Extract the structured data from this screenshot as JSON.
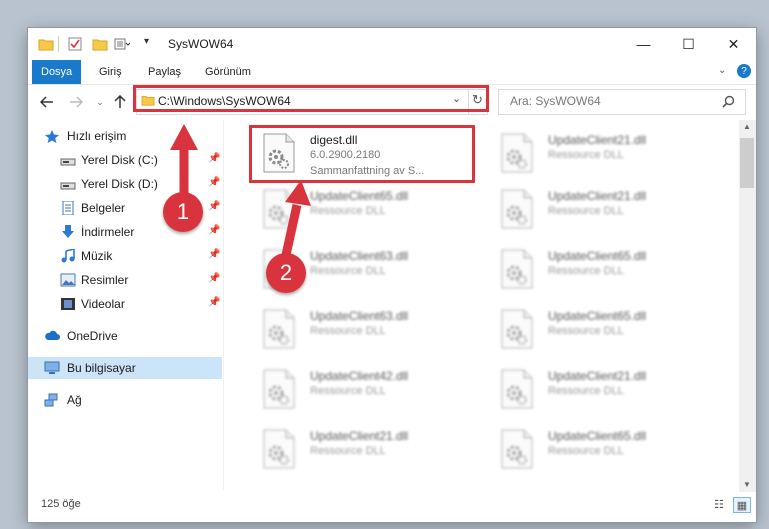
{
  "window": {
    "title": "SysWOW64",
    "minimize_glyph": "—",
    "maximize_glyph": "☐",
    "close_glyph": "✕"
  },
  "ribbon": {
    "tabs": [
      "Dosya",
      "Giriş",
      "Paylaş",
      "Görünüm"
    ],
    "active_tab": "Dosya"
  },
  "address": {
    "path": "C:\\Windows\\SysWOW64"
  },
  "search": {
    "placeholder": "Ara: SysWOW64"
  },
  "sidebar": {
    "items": [
      {
        "label": "Hızlı erişim",
        "icon": "star-icon"
      },
      {
        "label": "Yerel Disk (C:)",
        "icon": "drive-icon",
        "pinned": true
      },
      {
        "label": "Yerel Disk (D:)",
        "icon": "drive-icon",
        "pinned": true
      },
      {
        "label": "Belgeler",
        "icon": "document-icon",
        "pinned": true
      },
      {
        "label": "İndirmeler",
        "icon": "download-icon",
        "pinned": true
      },
      {
        "label": "Müzik",
        "icon": "music-icon",
        "pinned": true
      },
      {
        "label": "Resimler",
        "icon": "pictures-icon",
        "pinned": true
      },
      {
        "label": "Videolar",
        "icon": "video-icon",
        "pinned": true
      },
      {
        "label": "OneDrive",
        "icon": "cloud-icon"
      },
      {
        "label": "Bu bilgisayar",
        "icon": "computer-icon",
        "selected": true
      },
      {
        "label": "Ağ",
        "icon": "network-icon"
      }
    ]
  },
  "files": [
    {
      "name": "digest.dll",
      "line1": "6.0.2900.2180",
      "line2": "Sammanfattning av S...",
      "blurred": false
    },
    {
      "name": "UpdateClient21.dll",
      "line1": "Ressource DLL",
      "blurred": true
    },
    {
      "name": "UpdateClient65.dll",
      "line1": "Ressource DLL",
      "blurred": true
    },
    {
      "name": "UpdateClient21.dll",
      "line1": "Ressource DLL",
      "blurred": true
    },
    {
      "name": "UpdateClient63.dll",
      "line1": "Ressource DLL",
      "blurred": true
    },
    {
      "name": "UpdateClient65.dll",
      "line1": "Ressource DLL",
      "blurred": true
    },
    {
      "name": "UpdateClient63.dll",
      "line1": "Ressource DLL",
      "blurred": true
    },
    {
      "name": "UpdateClient65.dll",
      "line1": "Ressource DLL",
      "blurred": true
    },
    {
      "name": "UpdateClient42.dll",
      "line1": "Ressource DLL",
      "blurred": true
    },
    {
      "name": "UpdateClient21.dll",
      "line1": "Ressource DLL",
      "blurred": true
    },
    {
      "name": "UpdateClient21.dll",
      "line1": "Ressource DLL",
      "blurred": true
    },
    {
      "name": "UpdateClient65.dll",
      "line1": "Ressource DLL",
      "blurred": true
    }
  ],
  "status": {
    "item_count": "125 öğe"
  },
  "annotations": {
    "marker1": "1",
    "marker2": "2"
  },
  "colors": {
    "accent": "#1979ca",
    "highlight": "#d9343d",
    "selection": "#cce4f7"
  }
}
